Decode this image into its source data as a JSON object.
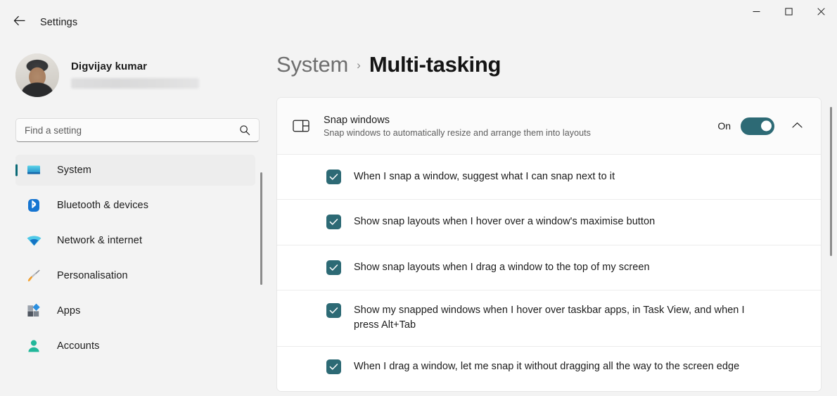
{
  "window": {
    "title": "Settings",
    "back_icon": "back-arrow-icon",
    "controls": {
      "minimize": "minimize-icon",
      "maximize": "maximize-icon",
      "close": "close-icon"
    }
  },
  "sidebar": {
    "account": {
      "name": "Digvijay kumar",
      "email_redacted": true
    },
    "search": {
      "placeholder": "Find a setting",
      "value": "",
      "icon": "search-icon"
    },
    "items": [
      {
        "label": "System",
        "icon": "monitor-icon",
        "selected": true
      },
      {
        "label": "Bluetooth & devices",
        "icon": "bluetooth-icon",
        "selected": false
      },
      {
        "label": "Network & internet",
        "icon": "wifi-icon",
        "selected": false
      },
      {
        "label": "Personalisation",
        "icon": "paintbrush-icon",
        "selected": false
      },
      {
        "label": "Apps",
        "icon": "apps-grid-icon",
        "selected": false
      },
      {
        "label": "Accounts",
        "icon": "person-icon",
        "selected": false
      }
    ]
  },
  "main": {
    "breadcrumb": {
      "parent": "System",
      "separator": "›",
      "current": "Multi-tasking"
    },
    "snap_card": {
      "icon": "snap-layout-icon",
      "title": "Snap windows",
      "subtitle": "Snap windows to automatically resize and arrange them into layouts",
      "toggle_state_label": "On",
      "toggle_on": true,
      "expand_icon": "chevron-up-icon",
      "options": [
        {
          "label": "When I snap a window, suggest what I can snap next to it",
          "checked": true
        },
        {
          "label": "Show snap layouts when I hover over a window's maximise button",
          "checked": true
        },
        {
          "label": "Show snap layouts when I drag a window to the top of my screen",
          "checked": true
        },
        {
          "label": "Show my snapped windows when I hover over taskbar apps, in Task View, and when I press Alt+Tab",
          "checked": true
        },
        {
          "label": "When I drag a window, let me snap it without dragging all the way to the screen edge",
          "checked": true
        }
      ]
    }
  },
  "colors": {
    "accent_teal": "#2d6a75",
    "selection_bar": "#0b6a77",
    "page_bg": "#f3f3f3",
    "card_bg": "#ffffff"
  }
}
